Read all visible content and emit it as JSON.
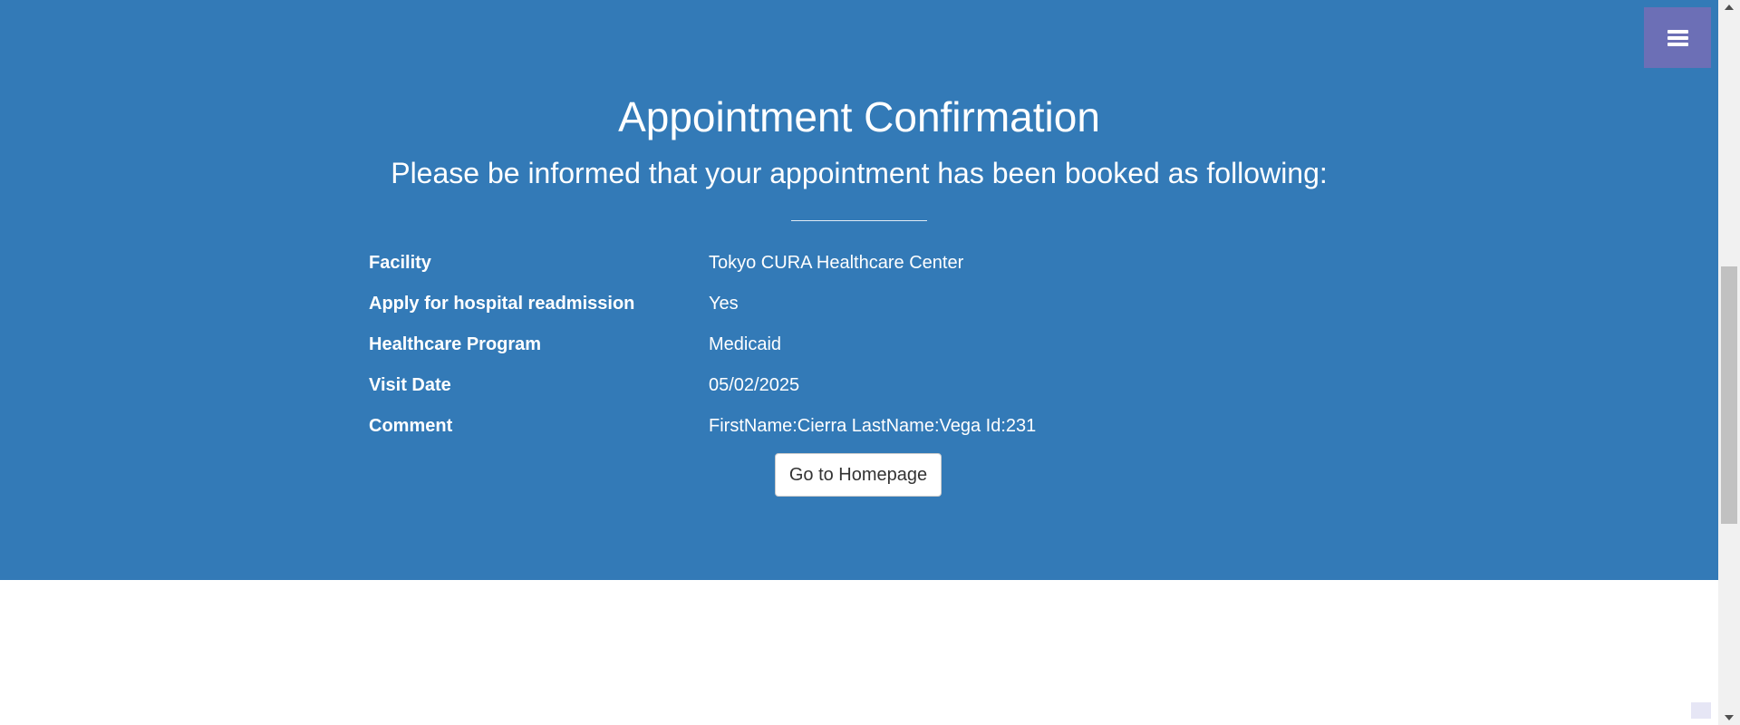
{
  "header": {
    "title": "Appointment Confirmation",
    "subtitle": "Please be informed that your appointment has been booked as following:"
  },
  "details": [
    {
      "label": "Facility",
      "value": "Tokyo CURA Healthcare Center"
    },
    {
      "label": "Apply for hospital readmission",
      "value": "Yes"
    },
    {
      "label": "Healthcare Program",
      "value": "Medicaid"
    },
    {
      "label": "Visit Date",
      "value": "05/02/2025"
    },
    {
      "label": "Comment",
      "value": "FirstName:Cierra LastName:Vega Id:231"
    }
  ],
  "actions": {
    "homepage_label": "Go to Homepage"
  },
  "menu": {
    "icon": "hamburger-icon"
  },
  "colors": {
    "hero_background": "#337ab7",
    "menu_toggle": "#6c6fb6",
    "text_on_hero": "#ffffff"
  }
}
